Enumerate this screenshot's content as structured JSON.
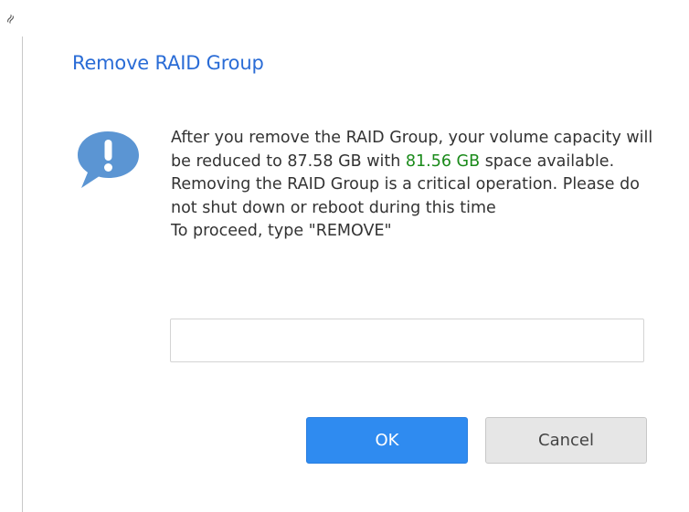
{
  "dialog": {
    "title": "Remove RAID Group",
    "message": {
      "part1": "After you remove the RAID Group, your volume capacity will be reduced to 87.58 GB with ",
      "highlight": "81.56 GB",
      "part2": " space available. Removing the RAID Group is a critical operation. Please do not shut down or reboot during this time",
      "instruction": "To proceed, type \"REMOVE\""
    },
    "confirm_input": {
      "value": "",
      "placeholder": ""
    },
    "buttons": {
      "ok_label": "OK",
      "cancel_label": "Cancel"
    }
  },
  "icons": {
    "warning": "exclamation-speech-bubble-icon",
    "corner": "resize-handle-icon"
  },
  "colors": {
    "title": "#2a6cd6",
    "highlight": "#1a8a1a",
    "ok_button": "#2f8bf0",
    "cancel_button": "#e6e6e6",
    "warning_icon": "#5b95d3"
  }
}
